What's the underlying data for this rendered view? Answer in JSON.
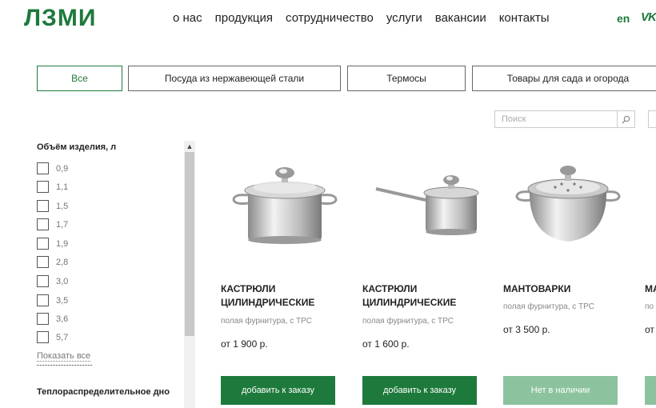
{
  "header": {
    "logo": "ЛЗМИ",
    "nav": [
      "о нас",
      "продукция",
      "сотрудничество",
      "услуги",
      "вакансии",
      "контакты"
    ],
    "lang": "en",
    "social": "VK"
  },
  "categories": [
    {
      "label": "Все",
      "active": true
    },
    {
      "label": "Посуда из нержавеющей стали",
      "active": false
    },
    {
      "label": "Термосы",
      "active": false
    },
    {
      "label": "Товары для сада и огорода",
      "active": false
    }
  ],
  "search": {
    "placeholder": "Поиск"
  },
  "filters": {
    "volume_title": "Объём изделия, л",
    "volume_options": [
      "0,9",
      "1,1",
      "1,5",
      "1,7",
      "1,9",
      "2,8",
      "3,0",
      "3,5",
      "3,6",
      "5,7"
    ],
    "show_all": "Показать все",
    "next_title": "Теплораспределительное дно"
  },
  "products": [
    {
      "name": "КАСТРЮЛИ ЦИЛИНДРИЧЕСКИЕ",
      "subtitle": "полая фурнитура, с ТРС",
      "price": "от 1 900 р.",
      "button": "добавить к заказу",
      "available": true,
      "image": "stock-pot"
    },
    {
      "name": "КАСТРЮЛИ ЦИЛИНДРИЧЕСКИЕ",
      "subtitle": "полая фурнитура, с ТРС",
      "price": "от 1 600 р.",
      "button": "добавить к заказу",
      "available": true,
      "image": "saucepan"
    },
    {
      "name": "МАНТОВАРКИ",
      "subtitle": "полая фурнитура, с ТРС",
      "price": "от 3 500 р.",
      "button": "Нет в наличии",
      "available": false,
      "image": "steamer-pot"
    },
    {
      "name": "МА",
      "subtitle": "по",
      "price": "от",
      "button": "",
      "available": true,
      "image": "partial"
    }
  ],
  "colors": {
    "brand": "#1e7a3c",
    "unavailable": "#8cc39e"
  }
}
